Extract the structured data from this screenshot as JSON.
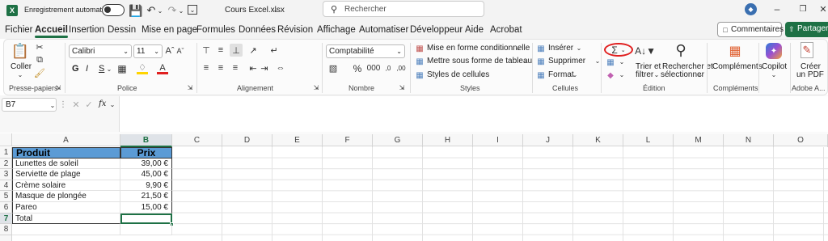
{
  "titlebar": {
    "autosave_label": "Enregistrement automatique",
    "filename": "Cours Excel.xlsx",
    "search_placeholder": "Rechercher"
  },
  "tabs": [
    "Fichier",
    "Accueil",
    "Insertion",
    "Dessin",
    "Mise en page",
    "Formules",
    "Données",
    "Révision",
    "Affichage",
    "Automatiser",
    "Développeur",
    "Aide",
    "Acrobat"
  ],
  "active_tab": "Accueil",
  "top_buttons": {
    "comments": "Commentaires",
    "share": "Partager"
  },
  "ribbon": {
    "clipboard": {
      "paste": "Coller",
      "group": "Presse-papiers"
    },
    "font": {
      "name": "Calibri",
      "size": "11",
      "bold": "G",
      "italic": "I",
      "underline": "S",
      "group": "Police"
    },
    "alignment": {
      "group": "Alignement"
    },
    "number": {
      "format": "Comptabilité",
      "group": "Nombre"
    },
    "styles": {
      "conditional": "Mise en forme conditionnelle",
      "table": "Mettre sous forme de tableau",
      "cell_styles": "Styles de cellules",
      "group": "Styles"
    },
    "cells": {
      "insert": "Insérer",
      "delete": "Supprimer",
      "format": "Format",
      "group": "Cellules"
    },
    "editing": {
      "sort_1": "Trier et",
      "sort_2": "filtrer",
      "find_1": "Rechercher et",
      "find_2": "sélectionner",
      "group": "Édition"
    },
    "addins": {
      "label": "Compléments",
      "group": "Compléments"
    },
    "copilot": {
      "label": "Copilot"
    },
    "adobe": {
      "label_1": "Créer",
      "label_2": "un PDF",
      "group": "Adobe A..."
    }
  },
  "formula_bar": {
    "name_box": "B7",
    "fx": "fx",
    "content": ""
  },
  "sheet": {
    "columns": [
      "A",
      "B",
      "C",
      "D",
      "E",
      "F",
      "G",
      "H",
      "I",
      "J",
      "K",
      "L",
      "M",
      "N",
      "O"
    ],
    "rows": [
      "1",
      "2",
      "3",
      "4",
      "5",
      "6",
      "7",
      "8"
    ],
    "header": {
      "a": "Produit",
      "b": "Prix"
    },
    "data": [
      {
        "a": "Lunettes de soleil",
        "b": "39,00 €"
      },
      {
        "a": "Serviette de plage",
        "b": "45,00 €"
      },
      {
        "a": "Crème solaire",
        "b": "9,90 €"
      },
      {
        "a": "Masque de plongée",
        "b": "21,50 €"
      },
      {
        "a": "Pareo",
        "b": "15,00 €"
      },
      {
        "a": "Total",
        "b": ""
      }
    ],
    "selected_cell": "B7",
    "header_fill": "#5b9bd5",
    "accent": "#1e7145"
  }
}
